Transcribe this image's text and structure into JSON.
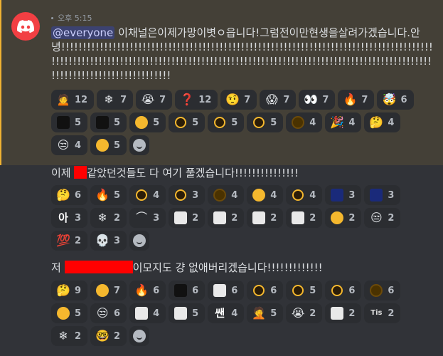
{
  "timestamp": "오후 5:15",
  "avatar_icon": "discord-logo-icon",
  "colors": {
    "avatar": "#f23f43",
    "highlight": "#444037",
    "highlight_bar": "#f0b232",
    "mention_bg": "#3c4270",
    "redaction": "#ff0000"
  },
  "messages": [
    {
      "mention": "@everyone",
      "text": " 이채널은이제가망이볏ㅇ읍니다!그럼전이만현생을살려가겠습니다.안녕!!!!!!!!!!!!!!!!!!!!!!!!!!!!!!!!!!!!!!!!!!!!!!!!!!!!!!!!!!!!!!!!!!!!!!!!!!!!!!!!!!!!!!!!!!!!!!!!!!!!!!!!!!!!!!!!!!!!!!!!!!!!!!!!!!!!!!!!!!!!!!!!!!!!!!!!!!!!!!!!!!!!!!!!!!!!!!!!!!!!!!!!!!!!!!!!!!!!!!!!!!!!",
      "reactions": [
        {
          "icon": "person-emoji",
          "glyph": "🙍",
          "count": "12"
        },
        {
          "icon": "snowflake-ball-emoji",
          "glyph": "❄",
          "count": "7"
        },
        {
          "icon": "crying-face-emoji",
          "glyph": "😭",
          "count": "7"
        },
        {
          "icon": "question-mark-emoji",
          "glyph": "❓",
          "count": "12"
        },
        {
          "icon": "raised-eyebrow-emoji",
          "glyph": "🤨",
          "count": "7"
        },
        {
          "icon": "screaming-face-emoji",
          "glyph": "😱",
          "count": "7"
        },
        {
          "icon": "eyes-emoji",
          "glyph": "👀",
          "count": "7"
        },
        {
          "icon": "fire-emoji",
          "glyph": "🔥",
          "count": "7"
        },
        {
          "icon": "exploding-head-emoji",
          "glyph": "🤯",
          "count": "6"
        },
        {
          "icon": "custom-photo-emoji-1",
          "glyph": "",
          "count": "5"
        },
        {
          "icon": "custom-photo-emoji-2",
          "glyph": "",
          "count": "5"
        },
        {
          "icon": "custom-round-face-emoji",
          "glyph": "",
          "count": "5"
        },
        {
          "icon": "custom-ring-emoji-1",
          "glyph": "",
          "count": "5"
        },
        {
          "icon": "custom-ring-emoji-2",
          "glyph": "",
          "count": "5"
        },
        {
          "icon": "custom-ring-emoji-3",
          "glyph": "",
          "count": "5"
        },
        {
          "icon": "custom-dark-ring-emoji",
          "glyph": "",
          "count": "4"
        },
        {
          "icon": "party-popper-emoji",
          "glyph": "🎉",
          "count": "4"
        },
        {
          "icon": "thinking-face-emoji",
          "glyph": "🤔",
          "count": "4"
        },
        {
          "icon": "unamused-face-emoji",
          "glyph": "😒",
          "count": "4"
        },
        {
          "icon": "custom-round-face-emoji-2",
          "glyph": "",
          "count": "5"
        }
      ]
    },
    {
      "text_before": "이제 ",
      "text_after": "같았던것들도 다 여기 풀겠습니다!!!!!!!!!!!!!!!",
      "reactions": [
        {
          "icon": "thinking-face-emoji",
          "glyph": "🤔",
          "count": "6"
        },
        {
          "icon": "fire-emoji",
          "glyph": "🔥",
          "count": "5"
        },
        {
          "icon": "custom-ring-emoji-1",
          "glyph": "",
          "count": "4"
        },
        {
          "icon": "custom-ring-emoji-2",
          "glyph": "",
          "count": "3"
        },
        {
          "icon": "custom-dark-ring-emoji",
          "glyph": "",
          "count": "4"
        },
        {
          "icon": "custom-round-face-emoji",
          "glyph": "",
          "count": "4"
        },
        {
          "icon": "custom-ring-emoji-3",
          "glyph": "",
          "count": "4"
        },
        {
          "icon": "custom-blue-image-emoji",
          "glyph": "",
          "count": "3"
        },
        {
          "icon": "custom-blue-image-emoji-2",
          "glyph": "",
          "count": "3"
        },
        {
          "icon": "korean-text-emoji",
          "glyph": "아",
          "count": "3"
        },
        {
          "icon": "snowflake-ball-emoji",
          "glyph": "❄",
          "count": "2"
        },
        {
          "icon": "frown-line-emoji",
          "glyph": "⌒",
          "count": "3"
        },
        {
          "icon": "custom-pixel-text-emoji",
          "glyph": "",
          "count": "2"
        },
        {
          "icon": "custom-white-text-emoji",
          "glyph": "",
          "count": "2"
        },
        {
          "icon": "custom-white-symbol-emoji",
          "glyph": "",
          "count": "2"
        },
        {
          "icon": "custom-arrow-emoji",
          "glyph": "",
          "count": "2"
        },
        {
          "icon": "custom-round-face-emoji-2",
          "glyph": "",
          "count": "2"
        },
        {
          "icon": "unamused-face-emoji",
          "glyph": "😒",
          "count": "2"
        },
        {
          "icon": "hundred-points-emoji",
          "glyph": "💯",
          "count": "2"
        },
        {
          "icon": "skull-emoji",
          "glyph": "💀",
          "count": "3"
        }
      ]
    },
    {
      "text_before": "저 ",
      "text_after": "이모지도 걍 없애버리겠습니다!!!!!!!!!!!!!",
      "reactions": [
        {
          "icon": "thinking-face-emoji",
          "glyph": "🤔",
          "count": "9"
        },
        {
          "icon": "custom-round-face-emoji",
          "glyph": "",
          "count": "7"
        },
        {
          "icon": "fire-emoji",
          "glyph": "🔥",
          "count": "6"
        },
        {
          "icon": "custom-photo-emoji-1",
          "glyph": "",
          "count": "6"
        },
        {
          "icon": "custom-pale-photo-emoji",
          "glyph": "",
          "count": "6"
        },
        {
          "icon": "custom-ring-emoji-1",
          "glyph": "",
          "count": "6"
        },
        {
          "icon": "custom-ring-emoji-2",
          "glyph": "",
          "count": "5"
        },
        {
          "icon": "custom-ring-emoji-3",
          "glyph": "",
          "count": "6"
        },
        {
          "icon": "custom-dark-ring-emoji",
          "glyph": "",
          "count": "6"
        },
        {
          "icon": "custom-round-face-emoji-2",
          "glyph": "",
          "count": "5"
        },
        {
          "icon": "unamused-face-emoji",
          "glyph": "😒",
          "count": "6"
        },
        {
          "icon": "custom-pixel-text-emoji",
          "glyph": "",
          "count": "4"
        },
        {
          "icon": "custom-flag-emoji",
          "glyph": "",
          "count": "5"
        },
        {
          "icon": "korean-text-emoji-2",
          "glyph": "쌘",
          "count": "4"
        },
        {
          "icon": "face-with-hand-emoji",
          "glyph": "🤦",
          "count": "5"
        },
        {
          "icon": "crying-face-emoji",
          "glyph": "😭",
          "count": "2"
        },
        {
          "icon": "custom-white-text-emoji",
          "glyph": "",
          "count": "2"
        },
        {
          "icon": "custom-text-emoji-tis",
          "glyph": "Tis",
          "count": "2"
        },
        {
          "icon": "snowflake-ball-emoji",
          "glyph": "❄",
          "count": "2"
        },
        {
          "icon": "nerd-face-emoji",
          "glyph": "🤓",
          "count": "2"
        }
      ]
    }
  ]
}
